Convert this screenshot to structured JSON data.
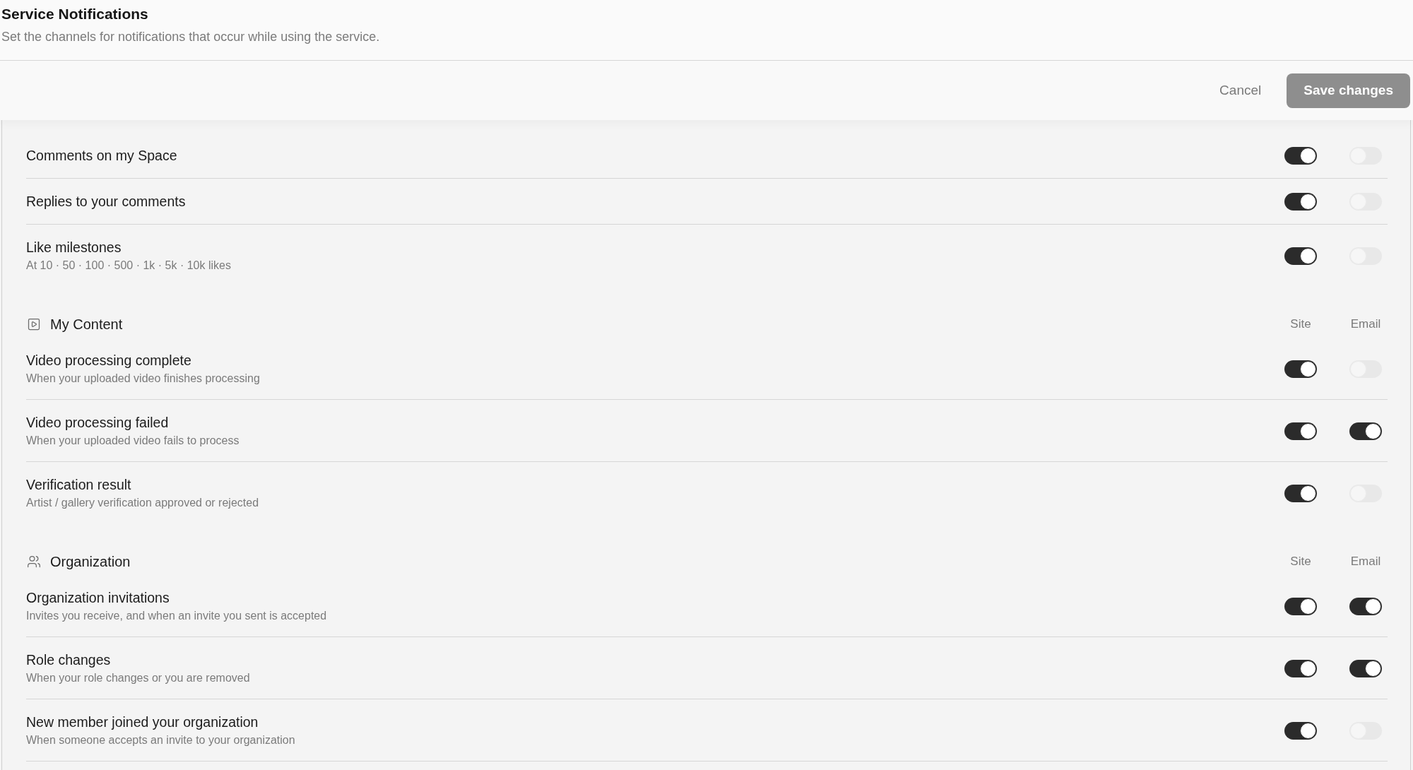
{
  "header": {
    "title": "Service Notifications",
    "subtitle": "Set the channels for notifications that occur while using the service."
  },
  "actions": {
    "cancel": "Cancel",
    "save": {
      "label": "Save changes",
      "disabled": true
    }
  },
  "sections": [
    {
      "rows": [
        {
          "title": "Comments on my Space",
          "site": true,
          "email": false
        },
        {
          "title": "Replies to your comments",
          "site": true,
          "email": false
        },
        {
          "title": "Like milestones",
          "description": "At 10 · 50 · 100 · 500 · 1k · 5k · 10k likes",
          "site": true,
          "email": false
        }
      ]
    },
    {
      "title": "My Content",
      "columns": [
        "Site",
        "Email"
      ],
      "rows": [
        {
          "title": "Video processing complete",
          "description": "When your uploaded video finishes processing",
          "site": true,
          "email": false
        },
        {
          "title": "Video processing failed",
          "description": "When your uploaded video fails to process",
          "site": true,
          "email": true
        },
        {
          "title": "Verification result",
          "description": "Artist / gallery verification approved or rejected",
          "site": true,
          "email": false
        }
      ]
    },
    {
      "title": "Organization",
      "columns": [
        "Site",
        "Email"
      ],
      "rows": [
        {
          "title": "Organization invitations",
          "description": "Invites you receive, and when an invite you sent is accepted",
          "site": true,
          "email": true
        },
        {
          "title": "Role changes",
          "description": "When your role changes or you are removed",
          "site": true,
          "email": true
        },
        {
          "title": "New member joined your organization",
          "description": "When someone accepts an invite to your organization",
          "site": true,
          "email": false
        }
      ]
    }
  ]
}
